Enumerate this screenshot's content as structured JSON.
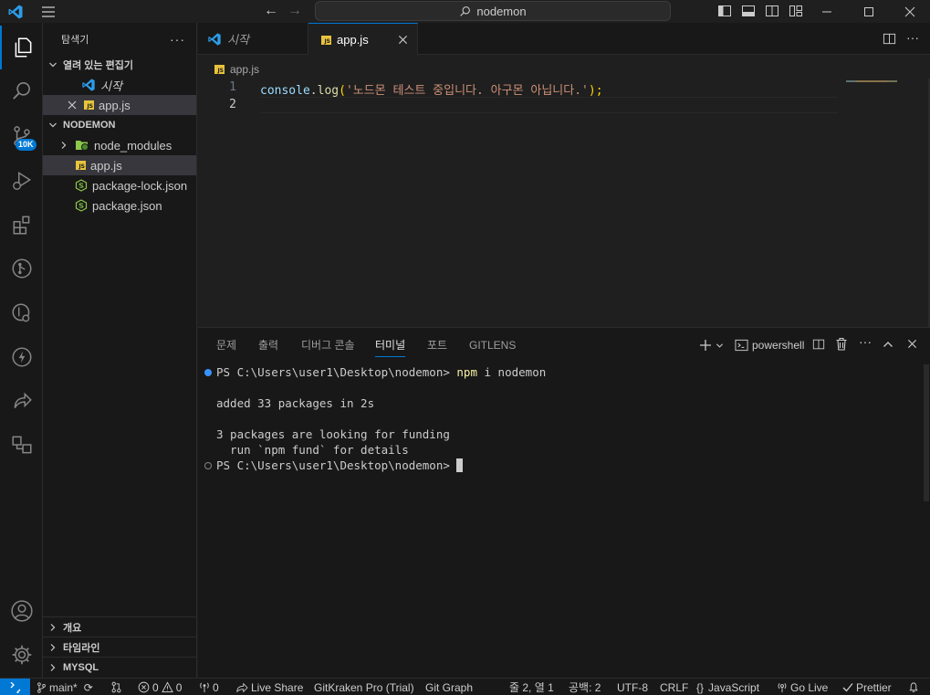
{
  "title_bar": {
    "search_text": "nodemon"
  },
  "sidebar": {
    "title": "탐색기",
    "open_editors_header": "열려 있는 편집기",
    "open_editors": [
      {
        "label": "시작"
      },
      {
        "label": "app.js"
      }
    ],
    "workspace_header": "NODEMON",
    "files": [
      {
        "label": "node_modules"
      },
      {
        "label": "app.js"
      },
      {
        "label": "package-lock.json"
      },
      {
        "label": "package.json"
      }
    ],
    "bottom_sections": [
      {
        "label": "개요"
      },
      {
        "label": "타임라인"
      },
      {
        "label": "MYSQL"
      }
    ]
  },
  "activity_bar": {
    "source_control_badge": "10K"
  },
  "editor": {
    "tabs": [
      {
        "label": "시작"
      },
      {
        "label": "app.js"
      }
    ],
    "breadcrumb": "app.js",
    "lines": [
      {
        "number": "1",
        "code_obj": "console",
        "code_dot": ".",
        "code_fn": "log",
        "code_open": "(",
        "code_str": "'노드몬 테스트 중입니다. 아구몬 아닙니다.'",
        "code_close": ");"
      },
      {
        "number": "2"
      }
    ]
  },
  "panel": {
    "tabs": [
      "문제",
      "출력",
      "디버그 콘솔",
      "터미널",
      "포트",
      "GITLENS"
    ],
    "active_tab_index": 3,
    "shell_name": "powershell",
    "terminal": {
      "prompt1": "PS C:\\Users\\user1\\Desktop\\nodemon> ",
      "command1_bin": "npm",
      "command1_args": " i nodemon",
      "out1": "added 33 packages in 2s",
      "out2": "3 packages are looking for funding",
      "out3": "  run `npm fund` for details",
      "prompt2": "PS C:\\Users\\user1\\Desktop\\nodemon> "
    }
  },
  "status_bar": {
    "branch": "main*",
    "errors": "0",
    "warnings": "0",
    "ports": "0",
    "live_share": "Live Share",
    "gitkraken": "GitKraken Pro (Trial)",
    "git_graph": "Git Graph",
    "cursor_pos": "줄 2, 열 1",
    "spaces": "공백: 2",
    "encoding": "UTF-8",
    "eol": "CRLF",
    "language": "JavaScript",
    "go_live": "Go Live",
    "prettier": "Prettier"
  },
  "colors": {
    "accent": "#0078d4",
    "js_icon": "#e8c33c",
    "string": "#ce9178",
    "function": "#dcdcaa",
    "variable": "#9cdcfe",
    "node_green": "#8cc84b"
  }
}
